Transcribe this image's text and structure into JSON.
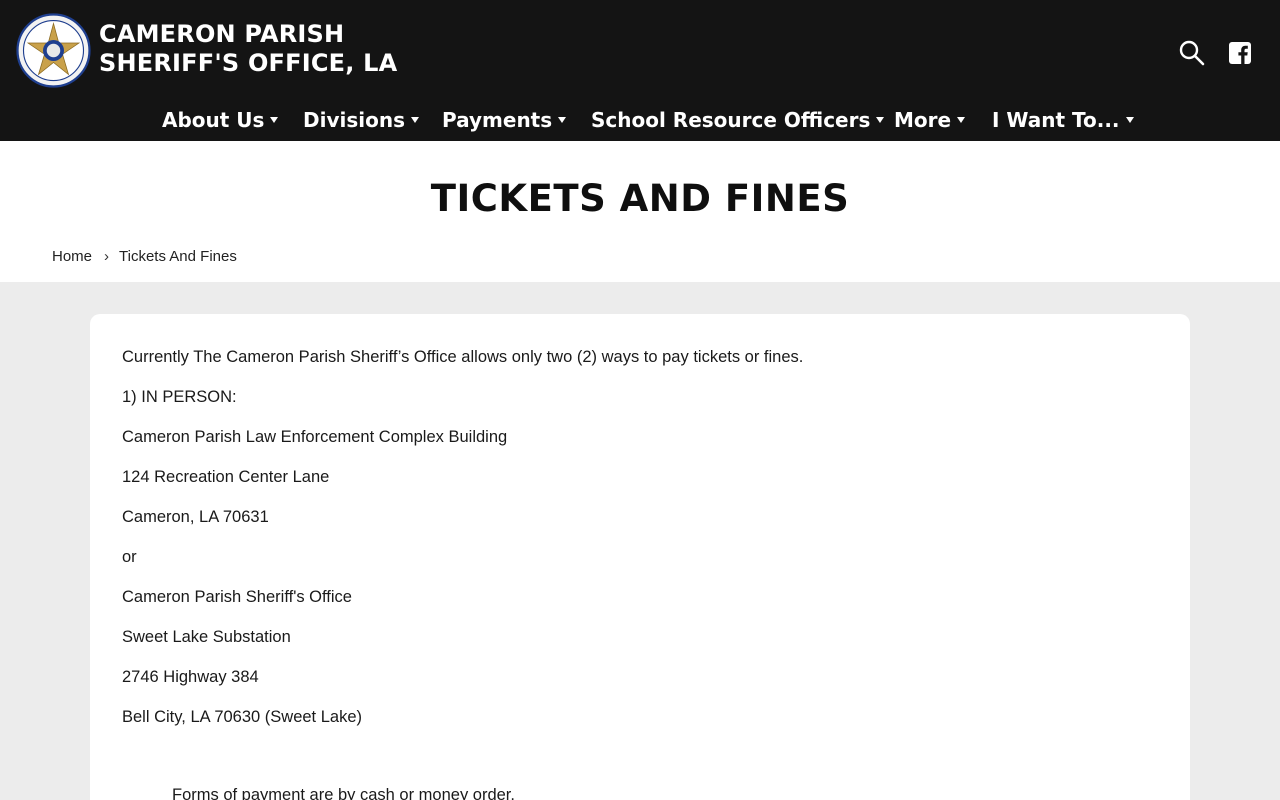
{
  "header": {
    "site_name_line1": "CAMERON PARISH",
    "site_name_line2": "SHERIFF'S OFFICE, LA",
    "logo_icon": "sheriff-star-badge",
    "search_icon": "search-icon",
    "facebook_icon": "facebook-icon"
  },
  "nav": {
    "items": [
      {
        "label": "About Us"
      },
      {
        "label": "Divisions"
      },
      {
        "label": "Payments"
      },
      {
        "label": "School Resource Officers"
      },
      {
        "label": "More"
      },
      {
        "label": "I Want To..."
      }
    ]
  },
  "page": {
    "title": "TICKETS AND FINES",
    "breadcrumb": {
      "home": "Home",
      "separator": "›",
      "current": "Tickets And Fines"
    }
  },
  "content": {
    "paragraphs": [
      "Currently The Cameron Parish Sheriff’s Office allows only two (2) ways to pay tickets or fines.",
      "1) IN PERSON:",
      "Cameron Parish Law Enforcement Complex Building",
      "124 Recreation Center Lane",
      "Cameron, LA 70631",
      "or",
      "Cameron Parish Sheriff's Office",
      "Sweet Lake Substation",
      "2746 Highway 384",
      "Bell City, LA 70630 (Sweet Lake)"
    ],
    "indented_note": "Forms of payment are by cash or money order."
  },
  "colors": {
    "header_bg": "#141414",
    "page_bg": "#ececec",
    "card_bg": "#ffffff",
    "text": "#1a1a1a",
    "badge_gold": "#c9a14a",
    "badge_blue": "#1f3f8f"
  }
}
